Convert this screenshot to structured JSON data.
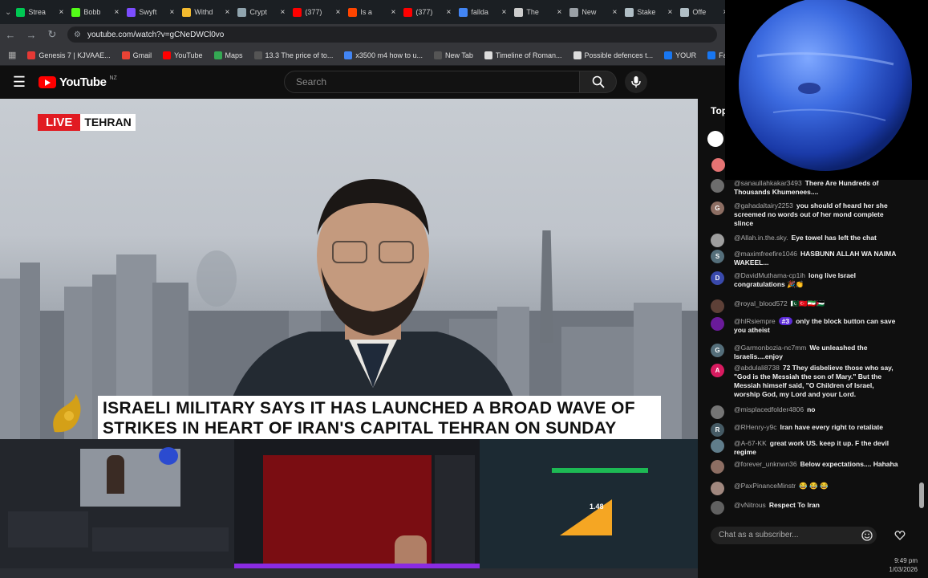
{
  "tabs": [
    {
      "label": "Strea",
      "color": "#00c853"
    },
    {
      "label": "Bobb",
      "color": "#53fc18"
    },
    {
      "label": "Swyft",
      "color": "#7c4dff"
    },
    {
      "label": "Withd",
      "color": "#f3ba2f"
    },
    {
      "label": "Crypt",
      "color": "#90a4ae"
    },
    {
      "label": "(377)",
      "color": "#ff0000"
    },
    {
      "label": "Is a",
      "color": "#ff4500"
    },
    {
      "label": "(377)",
      "color": "#ff0000"
    },
    {
      "label": "fallda",
      "color": "#4285f4"
    },
    {
      "label": "The",
      "color": "#cccccc"
    },
    {
      "label": "New",
      "color": "#9aa0a6"
    },
    {
      "label": "Stake",
      "color": "#b0bec5"
    },
    {
      "label": "Offe",
      "color": "#b0bec5"
    }
  ],
  "address": {
    "url": "youtube.com/watch?v=gCNeDWCl0vo"
  },
  "bookmarks": [
    {
      "label": "Genesis 7 | KJVAAE...",
      "color": "#e53935"
    },
    {
      "label": "Gmail",
      "color": "#ea4335"
    },
    {
      "label": "YouTube",
      "color": "#ff0000"
    },
    {
      "label": "Maps",
      "color": "#34a853"
    },
    {
      "label": "13.3 The price of to...",
      "color": "#555555"
    },
    {
      "label": "x3500 m4 how to u...",
      "color": "#4285f4"
    },
    {
      "label": "New Tab",
      "color": "#555555"
    },
    {
      "label": "Timeline of Roman...",
      "color": "#dddddd"
    },
    {
      "label": "Possible defences t...",
      "color": "#dddddd"
    },
    {
      "label": "YOUR",
      "color": "#1877f2"
    },
    {
      "label": "Facebook green",
      "color": "#1877f2"
    }
  ],
  "youtube": {
    "logo": "YouTube",
    "country": "NZ",
    "search_placeholder": "Search"
  },
  "video": {
    "live_label": "LIVE",
    "location": "TEHRAN",
    "caption_line1": "ISRAELI MILITARY SAYS IT HAS LAUNCHED A BROAD WAVE OF",
    "caption_line2": "STRIKES IN HEART OF IRAN'S CAPITAL TEHRAN ON SUNDAY"
  },
  "chat": {
    "header": "Top",
    "input_placeholder": "Chat as a subscriber...",
    "messages": [
      {
        "author": "@sanaullahkakar3493",
        "text": "There Are Hundreds of Thousands Khumenees....",
        "avatar_letter": "",
        "avatar_color": "#6d6d6d"
      },
      {
        "author": "@gahadaltairy2253",
        "text": "you should of heard her she screemed no words out of her mond complete slince",
        "avatar_letter": "G",
        "avatar_color": "#8d6e63"
      },
      {
        "author": "@Allah.in.the.sky.",
        "text": "Eye towel has left the chat",
        "avatar_letter": "",
        "avatar_color": "#9e9e9e"
      },
      {
        "author": "@maximfreefire1046",
        "text": "HASBUNN ALLAH WA NAIMA WAKEEL...",
        "avatar_letter": "S",
        "avatar_color": "#546e7a"
      },
      {
        "author": "@DavidMuthama-cp1ih",
        "text": "long live Israel congratulations 🎉👏",
        "avatar_letter": "D",
        "avatar_color": "#3949ab"
      },
      {
        "author": "@royal_blood572",
        "text": "🇵🇰🇹🇷🇮🇷🇵🇸",
        "avatar_letter": "",
        "avatar_color": "#5d4037"
      },
      {
        "author": "@hlRsiempre",
        "text": "only the block button can save you atheist",
        "badge": "#3",
        "avatar_letter": "",
        "avatar_color": "#6a1b9a"
      },
      {
        "author": "@Garmonbozia-nc7mm",
        "text": "We unleashed the Israelis....enjoy",
        "avatar_letter": "G",
        "avatar_color": "#546e7a"
      },
      {
        "author": "@abdulali8738",
        "text": "72  They disbelieve those who say, \"God is the Messiah the son of Mary.\" But the Messiah himself said, \"O Children of Israel, worship God, my Lord and your Lord.",
        "avatar_letter": "A",
        "avatar_color": "#d81b60"
      },
      {
        "author": "@misplacedfolder4806",
        "text": "no",
        "avatar_letter": "",
        "avatar_color": "#757575"
      },
      {
        "author": "@RHenry-y9c",
        "text": "Iran have every right to retaliate",
        "avatar_letter": "R",
        "avatar_color": "#455a64"
      },
      {
        "author": "@A-67-KK",
        "text": "great work US. keep it up. F the devil regime",
        "avatar_letter": "",
        "avatar_color": "#607d8b"
      },
      {
        "author": "@forever_unknwn36",
        "text": "Below expectations.... Hahaha",
        "avatar_letter": "",
        "avatar_color": "#8d6e63"
      },
      {
        "author": "@PaxPinanceMinstr",
        "text": "😂 😂 😂",
        "avatar_letter": "",
        "avatar_color": "#a1887f"
      },
      {
        "author": "@vNitrous",
        "text": "Respect To Iran",
        "avatar_letter": "",
        "avatar_color": "#616161"
      }
    ]
  },
  "clock": {
    "time": "9:49 pm",
    "date": "1/03/2026"
  },
  "obs_preview": {
    "value_label": "1.48"
  }
}
